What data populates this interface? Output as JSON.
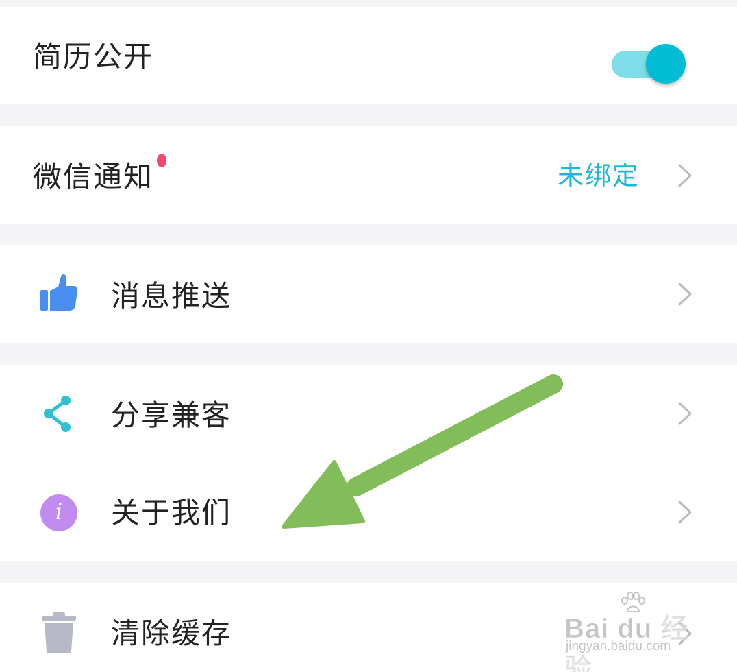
{
  "settings": {
    "resume_public": {
      "label": "简历公开",
      "toggle_on": true
    },
    "wechat_notify": {
      "label": "微信通知",
      "status": "未绑定",
      "has_badge": true
    },
    "push": {
      "label": "消息推送",
      "icon": "thumbs-up-icon"
    },
    "share": {
      "label": "分享兼客",
      "icon": "share-icon"
    },
    "about": {
      "label": "关于我们",
      "icon": "info-icon",
      "icon_glyph": "i"
    },
    "clear_cache": {
      "label": "清除缓存",
      "icon": "trash-icon"
    }
  },
  "watermark": {
    "brand": "Bai du 经验",
    "url": "jingyan.baidu.com"
  },
  "colors": {
    "accent": "#1ab8d6",
    "toggle_track": "#7fdde9",
    "toggle_knob": "#00bcd4",
    "badge": "#ef4c6f",
    "thumb_icon": "#4a8ef0",
    "share_icon": "#2fc1d0",
    "info_icon": "#c28bf0",
    "trash_icon": "#b8b9c6",
    "arrow": "#82bd5a",
    "chevron": "#b9b9b9"
  }
}
